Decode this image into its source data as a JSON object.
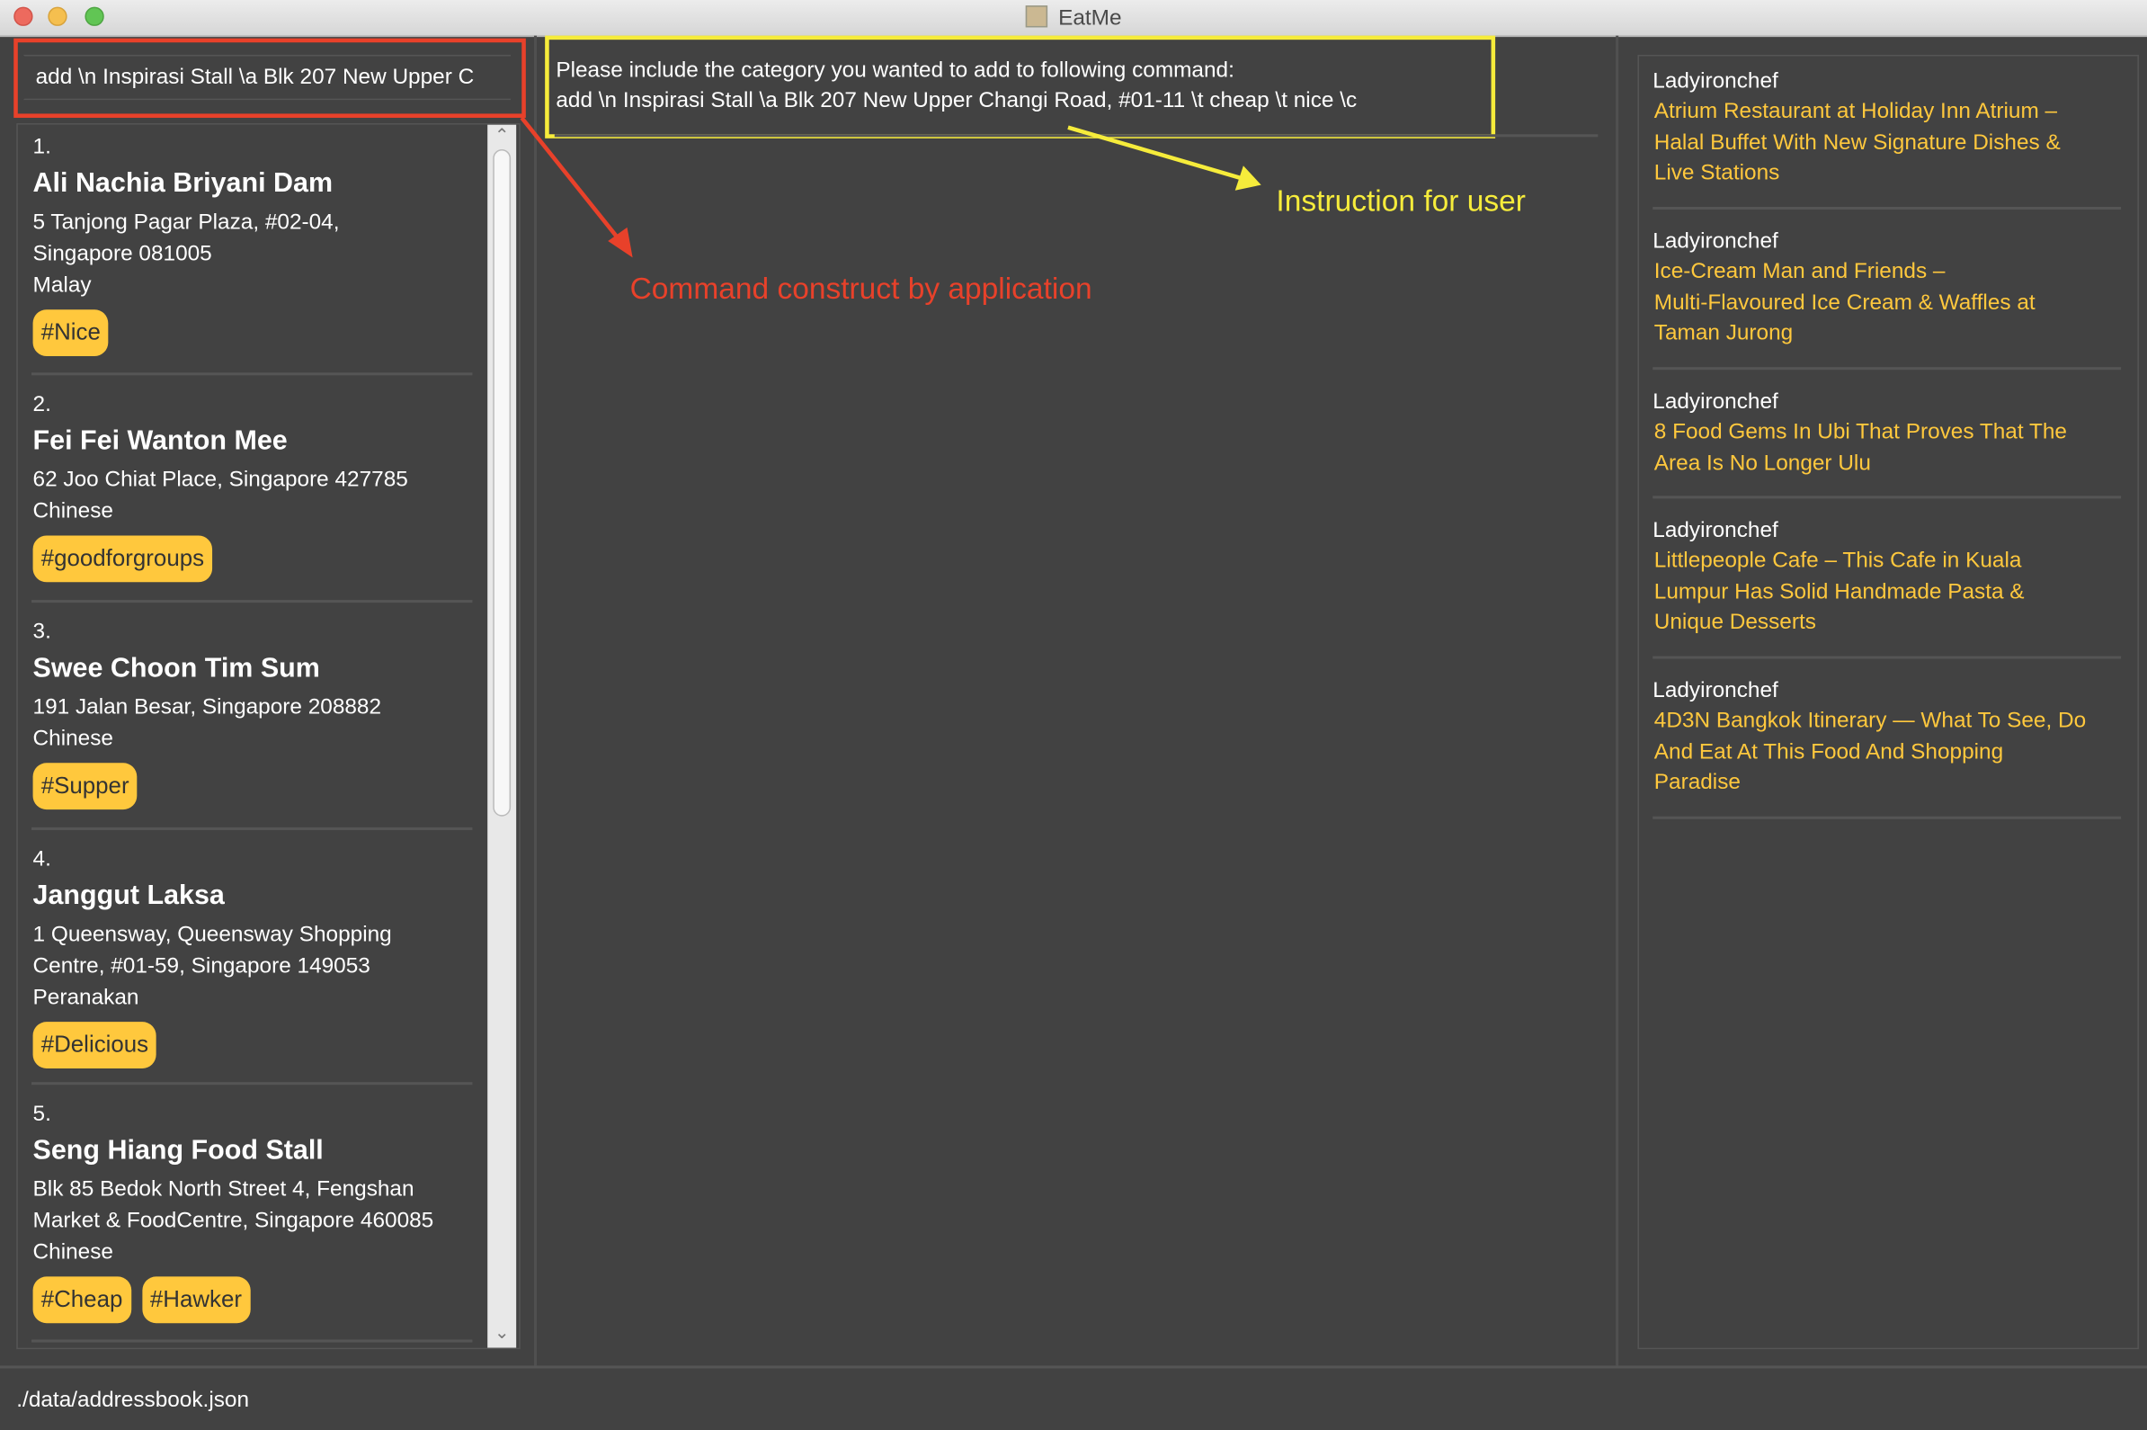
{
  "window": {
    "title": "EatMe"
  },
  "command_box": {
    "value": "add \\n Inspirasi Stall \\a Blk 207 New Upper C"
  },
  "result_display": {
    "line1": "Please include the category you wanted to add to following command:",
    "line2": "add \\n Inspirasi Stall \\a Blk 207 New Upper Changi Road, #01-11 \\t cheap \\t nice  \\c"
  },
  "restaurants": [
    {
      "index": "1.",
      "name": "Ali Nachia Briyani Dam",
      "address_lines": [
        "5 Tanjong Pagar Plaza, #02-04,",
        "Singapore 081005"
      ],
      "category": "Malay",
      "tags": [
        "#Nice"
      ]
    },
    {
      "index": "2.",
      "name": "Fei Fei Wanton Mee",
      "address_lines": [
        "62 Joo Chiat Place, Singapore 427785"
      ],
      "category": "Chinese",
      "tags": [
        "#goodforgroups"
      ]
    },
    {
      "index": "3.",
      "name": "Swee Choon Tim Sum",
      "address_lines": [
        "191 Jalan Besar, Singapore 208882"
      ],
      "category": "Chinese",
      "tags": [
        "#Supper"
      ]
    },
    {
      "index": "4.",
      "name": "Janggut Laksa",
      "address_lines": [
        "1 Queensway, Queensway Shopping",
        "Centre, #01-59, Singapore 149053"
      ],
      "category": "Peranakan",
      "tags": [
        "#Delicious"
      ]
    },
    {
      "index": "5.",
      "name": "Seng Hiang Food Stall",
      "address_lines": [
        "Blk 85 Bedok North Street 4, Fengshan",
        "Market & FoodCentre, Singapore 460085"
      ],
      "category": "Chinese",
      "tags": [
        "#Cheap",
        "#Hawker"
      ]
    }
  ],
  "news_feed": [
    {
      "source": "Ladyironchef",
      "title_lines": [
        "Atrium Restaurant at Holiday Inn Atrium –",
        "Halal Buffet With New Signature Dishes &",
        "Live Stations"
      ]
    },
    {
      "source": "Ladyironchef",
      "title_lines": [
        "Ice-Cream Man and Friends –",
        "Multi-Flavoured Ice Cream & Waffles at",
        "Taman Jurong"
      ]
    },
    {
      "source": "Ladyironchef",
      "title_lines": [
        "8 Food Gems In Ubi That Proves That The",
        "Area Is No Longer Ulu"
      ]
    },
    {
      "source": "Ladyironchef",
      "title_lines": [
        "Littlepeople Cafe – This Cafe in Kuala",
        "Lumpur Has Solid Handmade Pasta &",
        "Unique Desserts"
      ]
    },
    {
      "source": "Ladyironchef",
      "title_lines": [
        "4D3N Bangkok Itinerary — What To See, Do",
        "And Eat At This Food And Shopping",
        "Paradise"
      ]
    }
  ],
  "status_bar": {
    "file_path": "./data/addressbook.json"
  },
  "annotations": {
    "command_label": "Command construct by application",
    "instruction_label": "Instruction for user",
    "command_color": "#e8412a",
    "instruction_color": "#f6ec3b"
  },
  "colors": {
    "background": "#424242",
    "tag": "#ffc83d",
    "news_title": "#ffc83d"
  }
}
